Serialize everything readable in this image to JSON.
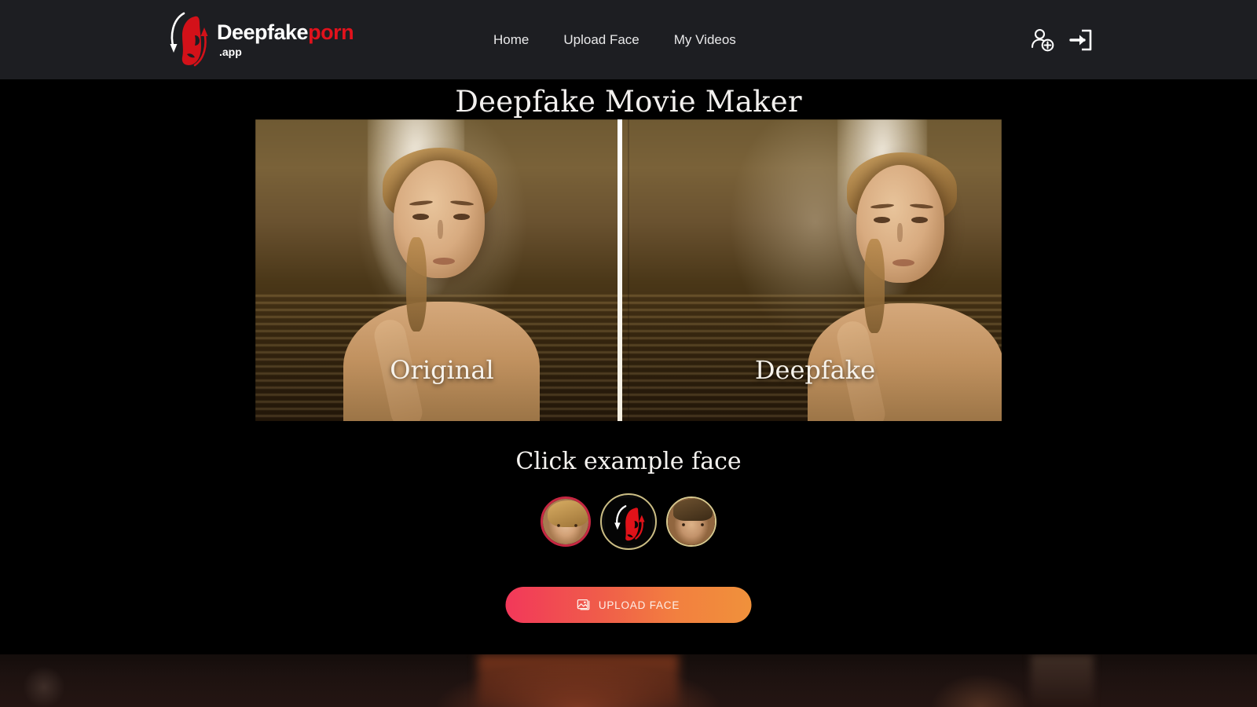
{
  "header": {
    "logo": {
      "word_primary": "Deepfake",
      "word_accent": "porn",
      "suffix": ".app",
      "mark_icon": "deepfake-face-swap-logo-icon",
      "primary_color": "#ffffff",
      "accent_color": "#e1121c"
    },
    "nav": [
      {
        "label": "Home",
        "name": "nav-home"
      },
      {
        "label": "Upload Face",
        "name": "nav-upload-face"
      },
      {
        "label": "My Videos",
        "name": "nav-my-videos"
      }
    ],
    "actions": [
      {
        "icon": "user-plus-icon",
        "name": "register-button"
      },
      {
        "icon": "sign-in-icon",
        "name": "login-button"
      }
    ],
    "background_color": "#1d1e22"
  },
  "main": {
    "page_title": "Deepfake Movie Maker",
    "comparison": {
      "left_label": "Original",
      "right_label": "Deepfake",
      "divider_color": "#ffffff"
    },
    "examples": {
      "title": "Click example face",
      "faces": [
        {
          "name": "example-face-1",
          "alt": "female-example-face",
          "ring_color": "#c62742",
          "selected": true
        },
        {
          "name": "example-face-logo",
          "alt": "deepfake-logo-face",
          "ring_color": "#cbbd84",
          "selected": false
        },
        {
          "name": "example-face-3",
          "alt": "male-example-face",
          "ring_color": "#d8c98f",
          "selected": false
        }
      ]
    },
    "upload_button": {
      "label": "UPLOAD FACE",
      "icon": "image-upload-icon",
      "gradient_start": "#f2385a",
      "gradient_end": "#f0913b"
    }
  }
}
